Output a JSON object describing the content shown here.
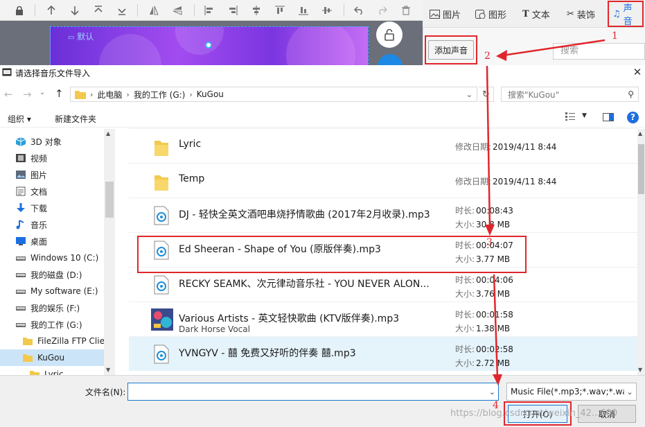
{
  "editor": {
    "slide_label": "默认",
    "tabs": [
      {
        "label": "图片",
        "icon": "image-icon"
      },
      {
        "label": "图形",
        "icon": "shape-icon"
      },
      {
        "label": "文本",
        "icon": "text-icon"
      },
      {
        "label": "装饰",
        "icon": "decoration-icon"
      },
      {
        "label": "声音",
        "icon": "music-note-icon",
        "active": true
      }
    ],
    "add_sound_label": "添加声音",
    "search_placeholder": "搜索"
  },
  "dialog": {
    "title": "请选择音乐文件导入",
    "breadcrumb": [
      "此电脑",
      "我的工作 (G:)",
      "KuGou"
    ],
    "search_placeholder": "搜索\"KuGou\"",
    "organize_label": "组织 ▾",
    "new_folder_label": "新建文件夹",
    "nav_items": [
      {
        "label": "3D 对象",
        "icon": "cube-icon"
      },
      {
        "label": "视频",
        "icon": "video-icon"
      },
      {
        "label": "图片",
        "icon": "picture-icon"
      },
      {
        "label": "文档",
        "icon": "document-icon"
      },
      {
        "label": "下载",
        "icon": "download-icon"
      },
      {
        "label": "音乐",
        "icon": "music-icon"
      },
      {
        "label": "桌面",
        "icon": "desktop-icon"
      },
      {
        "label": "Windows 10 (C:)",
        "icon": "drive-icon"
      },
      {
        "label": "我的磁盘 (D:)",
        "icon": "drive-icon"
      },
      {
        "label": "My software (E:)",
        "icon": "drive-icon"
      },
      {
        "label": "我的娱乐 (F:)",
        "icon": "drive-icon"
      },
      {
        "label": "我的工作 (G:)",
        "icon": "drive-icon"
      },
      {
        "label": "FileZilla FTP Clier",
        "icon": "folder-icon"
      },
      {
        "label": "KuGou",
        "icon": "folder-icon",
        "selected": true
      },
      {
        "label": "Lyric",
        "icon": "folder-icon"
      }
    ],
    "files": [
      {
        "name": "Lyric",
        "type": "folder",
        "meta1_label": "修改日期:",
        "meta1_value": "2019/4/11 8:44"
      },
      {
        "name": "Temp",
        "type": "folder",
        "meta1_label": "修改日期:",
        "meta1_value": "2019/4/11 8:44"
      },
      {
        "name": "DJ - 轻快全英文酒吧串烧抒情歌曲 (2017年2月收录).mp3",
        "type": "audio",
        "meta1_label": "时长:",
        "meta1_value": "00:08:43",
        "meta2_label": "大小:",
        "meta2_value": "30.8 MB"
      },
      {
        "name": "Ed Sheeran - Shape of You (原版伴奏).mp3",
        "type": "audio",
        "meta1_label": "时长:",
        "meta1_value": "00:04:07",
        "meta2_label": "大小:",
        "meta2_value": "3.77 MB"
      },
      {
        "name": "RECKY SEAMK、次元律动音乐社 - YOU NEVER ALON...",
        "type": "audio",
        "meta1_label": "时长:",
        "meta1_value": "00:04:06",
        "meta2_label": "大小:",
        "meta2_value": "3.76 MB"
      },
      {
        "name": "Various Artists - 英文轻快歌曲 (KTV版伴奏).mp3",
        "subtitle": "Dark Horse Vocal",
        "type": "album",
        "meta1_label": "时长:",
        "meta1_value": "00:01:58",
        "meta2_label": "大小:",
        "meta2_value": "1.38 MB"
      },
      {
        "name": "YVNGYV - 囍 免费又好听的伴奏 囍.mp3",
        "type": "audio",
        "selected": true,
        "meta1_label": "时长:",
        "meta1_value": "00:02:58",
        "meta2_label": "大小:",
        "meta2_value": "2.72 MB"
      }
    ],
    "filename_label": "文件名(N):",
    "filename_value": "",
    "filter_value": "Music File(*.mp3;*.wav;*.wam",
    "open_label": "打开(O)",
    "cancel_label": "取消"
  },
  "annotations": [
    "1",
    "2",
    "3",
    "4"
  ],
  "watermark": "https://blog.csdn.net/weixin_42...600",
  "colors": {
    "accent": "#1d6fe0",
    "annotation_red": "#e0262c",
    "selection": "#cce4f7"
  }
}
